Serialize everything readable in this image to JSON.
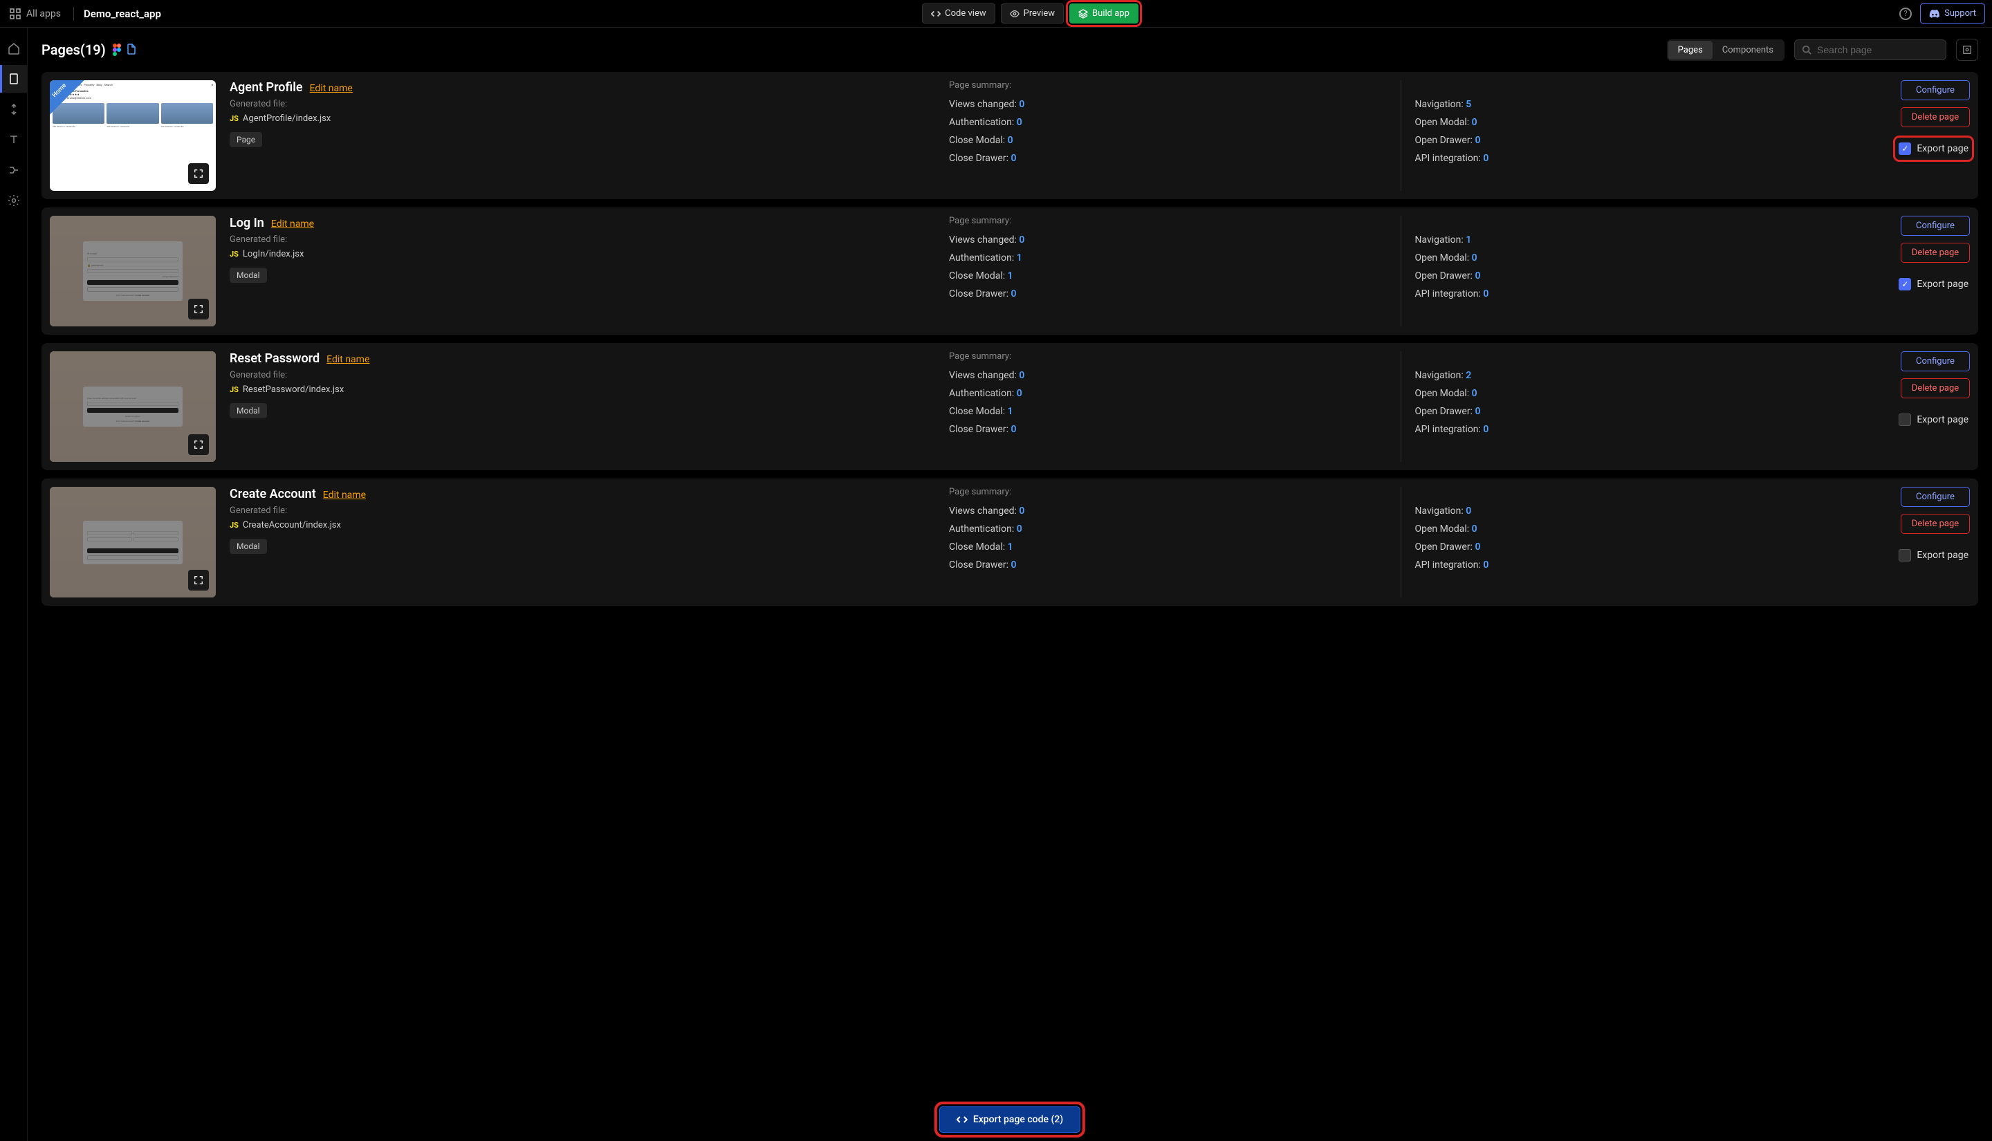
{
  "header": {
    "all_apps": "All apps",
    "app_title": "Demo_react_app",
    "code_view": "Code view",
    "preview": "Preview",
    "build_app": "Build app",
    "support": "Support"
  },
  "content_header": {
    "title": "Pages(19)",
    "tab_pages": "Pages",
    "tab_components": "Components",
    "search_placeholder": "Search page"
  },
  "labels": {
    "edit_name": "Edit name",
    "generated_file": "Generated file:",
    "page_summary": "Page summary:",
    "configure": "Configure",
    "delete_page": "Delete page",
    "export_page": "Export page",
    "views_changed": "Views changed:",
    "authentication": "Authentication:",
    "close_modal": "Close Modal:",
    "close_drawer": "Close Drawer:",
    "navigation": "Navigation:",
    "open_modal": "Open Modal:",
    "open_drawer": "Open Drawer:",
    "api_integration": "API integration:",
    "type_page": "Page",
    "type_modal": "Modal",
    "home_badge": "Home"
  },
  "export_bar": {
    "label": "Export page code (2)"
  },
  "pages": [
    {
      "name": "Agent Profile",
      "file": "AgentProfile/index.jsx",
      "type": "Page",
      "home_badge": true,
      "dimmed": false,
      "export_checked": true,
      "export_highlighted": true,
      "stats": {
        "views_changed": 0,
        "authentication": 0,
        "close_modal": 0,
        "close_drawer": 0,
        "navigation": 5,
        "open_modal": 0,
        "open_drawer": 0,
        "api_integration": 0
      }
    },
    {
      "name": "Log In",
      "file": "LogIn/index.jsx",
      "type": "Modal",
      "home_badge": false,
      "dimmed": true,
      "export_checked": true,
      "export_highlighted": false,
      "stats": {
        "views_changed": 0,
        "authentication": 1,
        "close_modal": 1,
        "close_drawer": 0,
        "navigation": 1,
        "open_modal": 0,
        "open_drawer": 0,
        "api_integration": 0
      }
    },
    {
      "name": "Reset Password",
      "file": "ResetPassword/index.jsx",
      "type": "Modal",
      "home_badge": false,
      "dimmed": true,
      "export_checked": false,
      "export_highlighted": false,
      "stats": {
        "views_changed": 0,
        "authentication": 0,
        "close_modal": 1,
        "close_drawer": 0,
        "navigation": 2,
        "open_modal": 0,
        "open_drawer": 0,
        "api_integration": 0
      }
    },
    {
      "name": "Create Account",
      "file": "CreateAccount/index.jsx",
      "type": "Modal",
      "home_badge": false,
      "dimmed": true,
      "export_checked": false,
      "export_highlighted": false,
      "stats": {
        "views_changed": 0,
        "authentication": 0,
        "close_modal": 1,
        "close_drawer": 0,
        "navigation": 0,
        "open_modal": 0,
        "open_drawer": 0,
        "api_integration": 0
      }
    }
  ]
}
